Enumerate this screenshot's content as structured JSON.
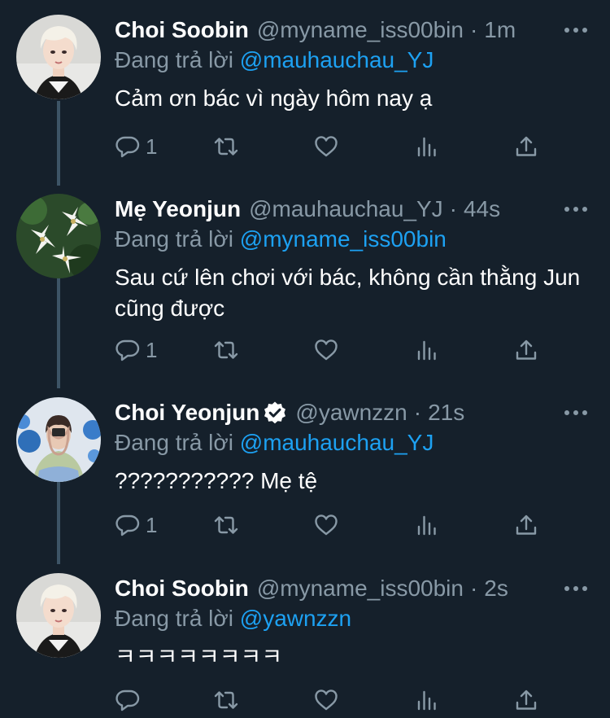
{
  "tweets": [
    {
      "name": "Choi Soobin",
      "handle": "@myname_iss00bin",
      "time": "1m",
      "verified": false,
      "reply_prefix": "Đang trả lời",
      "reply_to": "@mauhauchau_YJ",
      "text": "Cảm ơn bác vì ngày hôm nay ạ",
      "reply_count": "1"
    },
    {
      "name": "Mẹ Yeonjun",
      "handle": "@mauhauchau_YJ",
      "time": "44s",
      "verified": false,
      "reply_prefix": "Đang trả lời",
      "reply_to": "@myname_iss00bin",
      "text": "Sau cứ lên chơi với bác, không cần thằng Jun cũng được",
      "reply_count": "1"
    },
    {
      "name": "Choi Yeonjun",
      "handle": "@yawnzzn",
      "time": "21s",
      "verified": true,
      "reply_prefix": "Đang trả lời",
      "reply_to": "@mauhauchau_YJ",
      "text": "??????????? Mẹ tệ",
      "reply_count": "1"
    },
    {
      "name": "Choi Soobin",
      "handle": "@myname_iss00bin",
      "time": "2s",
      "verified": false,
      "reply_prefix": "Đang trả lời",
      "reply_to": "@yawnzzn",
      "text": "ㅋㅋㅋㅋㅋㅋㅋㅋ",
      "reply_count": ""
    }
  ],
  "separator": "·",
  "colors": {
    "background": "#15202b",
    "text_primary": "#ffffff",
    "text_secondary": "#8899a6",
    "mention": "#1da1f2",
    "thread_line": "#3d5466"
  }
}
